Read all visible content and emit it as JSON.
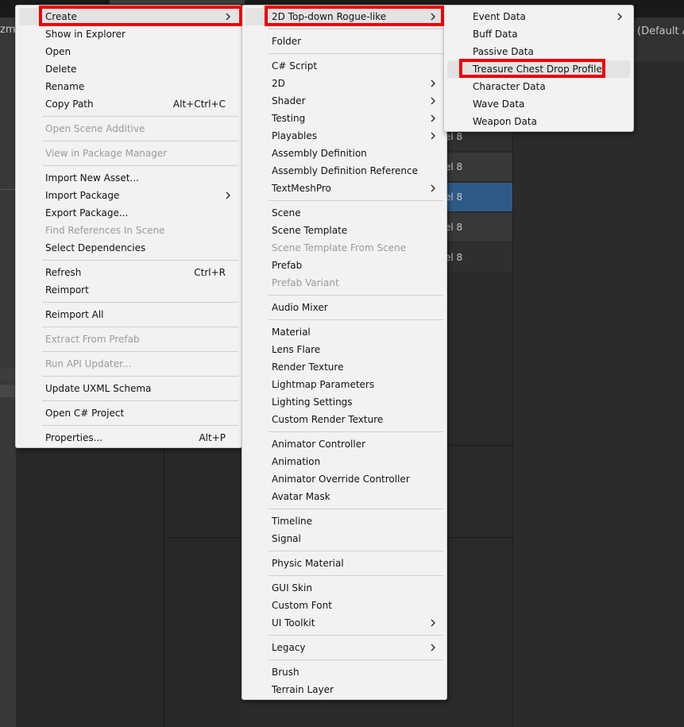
{
  "background": {
    "left_text": "zmo",
    "right_text": "(Default A",
    "list_rows": [
      "el 8",
      "el 8",
      "el 8",
      "el 8",
      "el 8"
    ],
    "selected_row": 2,
    "selected_color": "#2d5a87"
  },
  "menu1": {
    "items": [
      {
        "label": "Create",
        "arrow": true,
        "hover": true
      },
      {
        "label": "Show in Explorer"
      },
      {
        "label": "Open"
      },
      {
        "label": "Delete"
      },
      {
        "label": "Rename"
      },
      {
        "label": "Copy Path",
        "shortcut": "Alt+Ctrl+C"
      },
      {
        "sep": true
      },
      {
        "label": "Open Scene Additive",
        "disabled": true
      },
      {
        "sep": true
      },
      {
        "label": "View in Package Manager",
        "disabled": true
      },
      {
        "sep": true
      },
      {
        "label": "Import New Asset..."
      },
      {
        "label": "Import Package",
        "arrow": true
      },
      {
        "label": "Export Package..."
      },
      {
        "label": "Find References In Scene",
        "disabled": true
      },
      {
        "label": "Select Dependencies"
      },
      {
        "sep": true
      },
      {
        "label": "Refresh",
        "shortcut": "Ctrl+R"
      },
      {
        "label": "Reimport"
      },
      {
        "sep": true
      },
      {
        "label": "Reimport All"
      },
      {
        "sep": true
      },
      {
        "label": "Extract From Prefab",
        "disabled": true
      },
      {
        "sep": true
      },
      {
        "label": "Run API Updater...",
        "disabled": true
      },
      {
        "sep": true
      },
      {
        "label": "Update UXML Schema"
      },
      {
        "sep": true
      },
      {
        "label": "Open C# Project"
      },
      {
        "sep": true
      },
      {
        "label": "Properties...",
        "shortcut": "Alt+P"
      }
    ]
  },
  "menu2": {
    "items": [
      {
        "label": "2D Top-down Rogue-like",
        "arrow": true,
        "hover": true
      },
      {
        "sep": true
      },
      {
        "label": "Folder"
      },
      {
        "sep": true
      },
      {
        "label": "C# Script"
      },
      {
        "label": "2D",
        "arrow": true
      },
      {
        "label": "Shader",
        "arrow": true
      },
      {
        "label": "Testing",
        "arrow": true
      },
      {
        "label": "Playables",
        "arrow": true
      },
      {
        "label": "Assembly Definition"
      },
      {
        "label": "Assembly Definition Reference"
      },
      {
        "label": "TextMeshPro",
        "arrow": true
      },
      {
        "sep": true
      },
      {
        "label": "Scene"
      },
      {
        "label": "Scene Template"
      },
      {
        "label": "Scene Template From Scene",
        "disabled": true
      },
      {
        "label": "Prefab"
      },
      {
        "label": "Prefab Variant",
        "disabled": true
      },
      {
        "sep": true
      },
      {
        "label": "Audio Mixer"
      },
      {
        "sep": true
      },
      {
        "label": "Material"
      },
      {
        "label": "Lens Flare"
      },
      {
        "label": "Render Texture"
      },
      {
        "label": "Lightmap Parameters"
      },
      {
        "label": "Lighting Settings"
      },
      {
        "label": "Custom Render Texture"
      },
      {
        "sep": true
      },
      {
        "label": "Animator Controller"
      },
      {
        "label": "Animation"
      },
      {
        "label": "Animator Override Controller"
      },
      {
        "label": "Avatar Mask"
      },
      {
        "sep": true
      },
      {
        "label": "Timeline"
      },
      {
        "label": "Signal"
      },
      {
        "sep": true
      },
      {
        "label": "Physic Material"
      },
      {
        "sep": true
      },
      {
        "label": "GUI Skin"
      },
      {
        "label": "Custom Font"
      },
      {
        "label": "UI Toolkit",
        "arrow": true
      },
      {
        "sep": true
      },
      {
        "label": "Legacy",
        "arrow": true
      },
      {
        "sep": true
      },
      {
        "label": "Brush"
      },
      {
        "label": "Terrain Layer"
      }
    ]
  },
  "menu3": {
    "items": [
      {
        "label": "Event Data",
        "arrow": true
      },
      {
        "label": "Buff Data"
      },
      {
        "label": "Passive Data"
      },
      {
        "label": "Treasure Chest Drop Profile",
        "hover": true
      },
      {
        "label": "Character Data"
      },
      {
        "label": "Wave Data"
      },
      {
        "label": "Weapon Data"
      }
    ]
  },
  "highlight_color": "#ee0000"
}
